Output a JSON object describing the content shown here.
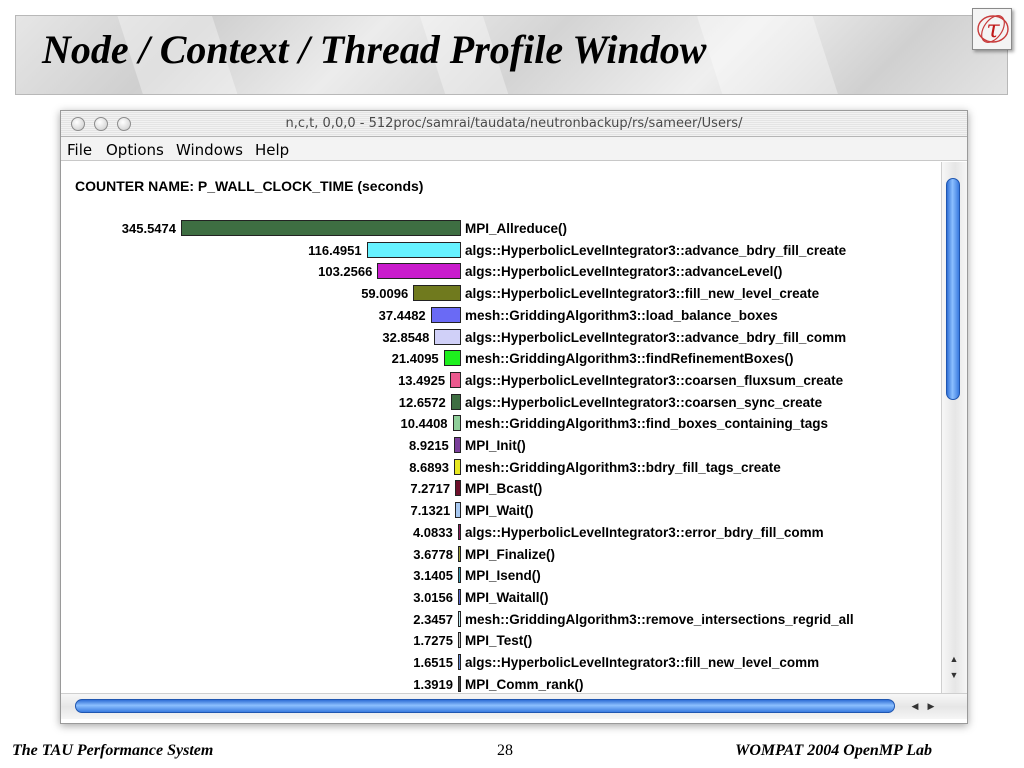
{
  "slide": {
    "title": "Node / Context / Thread Profile Window",
    "footer_left": "The TAU Performance System",
    "page_number": "28",
    "footer_right": "WOMPAT 2004 OpenMP Lab"
  },
  "window": {
    "title": "n,c,t, 0,0,0 - 512proc/samrai/taudata/neutronbackup/rs/sameer/Users/",
    "menus": [
      "File",
      "Options",
      "Windows",
      "Help"
    ]
  },
  "profile": {
    "counter_label": "COUNTER NAME: P_WALL_CLOCK_TIME (seconds)",
    "rows": [
      {
        "value": "345.5474",
        "name": "MPI_Allreduce()",
        "color": "#3e6e42"
      },
      {
        "value": "116.4951",
        "name": "algs::HyperbolicLevelIntegrator3::advance_bdry_fill_create",
        "color": "#66f2ff"
      },
      {
        "value": "103.2566",
        "name": "algs::HyperbolicLevelIntegrator3::advanceLevel()",
        "color": "#c91ccc"
      },
      {
        "value": "59.0096",
        "name": "algs::HyperbolicLevelIntegrator3::fill_new_level_create",
        "color": "#707a1e"
      },
      {
        "value": "37.4482",
        "name": "mesh::GriddingAlgorithm3::load_balance_boxes",
        "color": "#6a6af5"
      },
      {
        "value": "32.8548",
        "name": "algs::HyperbolicLevelIntegrator3::advance_bdry_fill_comm",
        "color": "#d0d0f8"
      },
      {
        "value": "21.4095",
        "name": "mesh::GriddingAlgorithm3::findRefinementBoxes()",
        "color": "#1ef01e"
      },
      {
        "value": "13.4925",
        "name": "algs::HyperbolicLevelIntegrator3::coarsen_fluxsum_create",
        "color": "#ea5a8e"
      },
      {
        "value": "12.6572",
        "name": "algs::HyperbolicLevelIntegrator3::coarsen_sync_create",
        "color": "#3e6e42"
      },
      {
        "value": "10.4408",
        "name": "mesh::GriddingAlgorithm3::find_boxes_containing_tags",
        "color": "#8fcf9a"
      },
      {
        "value": "8.9215",
        "name": "MPI_Init()",
        "color": "#7a3f9a"
      },
      {
        "value": "8.6893",
        "name": "mesh::GriddingAlgorithm3::bdry_fill_tags_create",
        "color": "#e6e620"
      },
      {
        "value": "7.2717",
        "name": "MPI_Bcast()",
        "color": "#6e0f2a"
      },
      {
        "value": "7.1321",
        "name": "MPI_Wait()",
        "color": "#a8c8f0"
      },
      {
        "value": "4.0833",
        "name": "algs::HyperbolicLevelIntegrator3::error_bdry_fill_comm",
        "color": "#8a1f5a"
      },
      {
        "value": "3.6778",
        "name": "MPI_Finalize()",
        "color": "#9a9a3a"
      },
      {
        "value": "3.1405",
        "name": "MPI_Isend()",
        "color": "#3a9ab0"
      },
      {
        "value": "3.0156",
        "name": "MPI_Waitall()",
        "color": "#5a6ad0"
      },
      {
        "value": "2.3457",
        "name": "mesh::GriddingAlgorithm3::remove_intersections_regrid_all",
        "color": "#c0e8f0"
      },
      {
        "value": "1.7275",
        "name": "MPI_Test()",
        "color": "#c0c0c0"
      },
      {
        "value": "1.6515",
        "name": "algs::HyperbolicLevelIntegrator3::fill_new_level_comm",
        "color": "#6a8ad0"
      },
      {
        "value": "1.3919",
        "name": "MPI_Comm_rank()",
        "color": "#4a4a4a"
      }
    ]
  }
}
